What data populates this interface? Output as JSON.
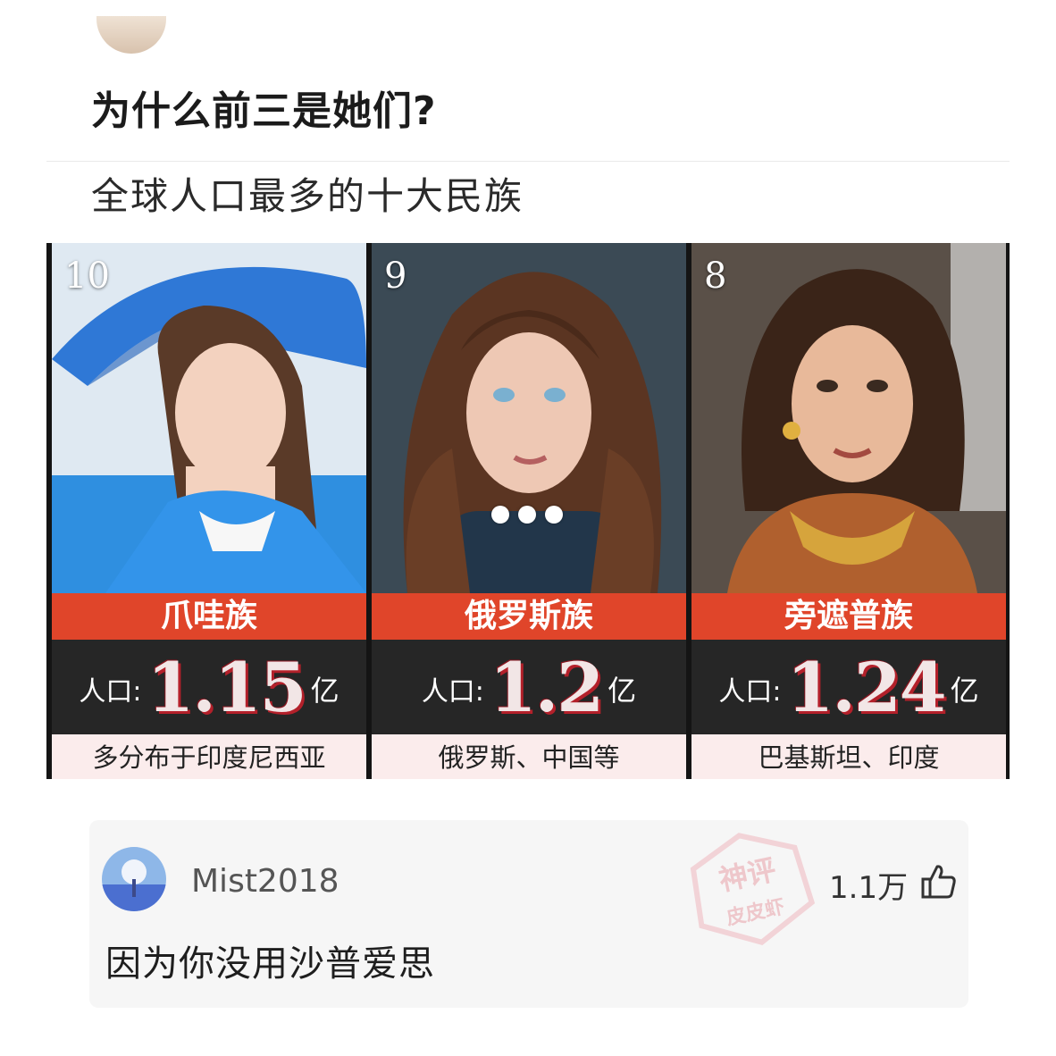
{
  "post": {
    "title": "为什么前三是她们?"
  },
  "card": {
    "heading": "全球人口最多的十大民族",
    "entries": [
      {
        "rank": "10",
        "name": "爪哇族",
        "population_label": "人口:",
        "population_value": "1.15",
        "population_unit": "亿",
        "region": "多分布于印度尼西亚"
      },
      {
        "rank": "9",
        "name": "俄罗斯族",
        "population_label": "人口:",
        "population_value": "1.2",
        "population_unit": "亿",
        "region": "俄罗斯、中国等"
      },
      {
        "rank": "8",
        "name": "旁遮普族",
        "population_label": "人口:",
        "population_value": "1.24",
        "population_unit": "亿",
        "region": "巴基斯坦、印度"
      }
    ],
    "colors": {
      "name_bar": "#e0452a",
      "population_bar": "#262626",
      "region_bar": "#fbecec"
    }
  },
  "comment": {
    "username": "Mist2018",
    "likes": "1.1万",
    "text": "因为你没用沙普爱思",
    "icons": {
      "avatar": "avatar",
      "like": "thumbs-up-icon"
    }
  },
  "watermark": {
    "line1": "神评",
    "line2": "皮皮虾"
  }
}
